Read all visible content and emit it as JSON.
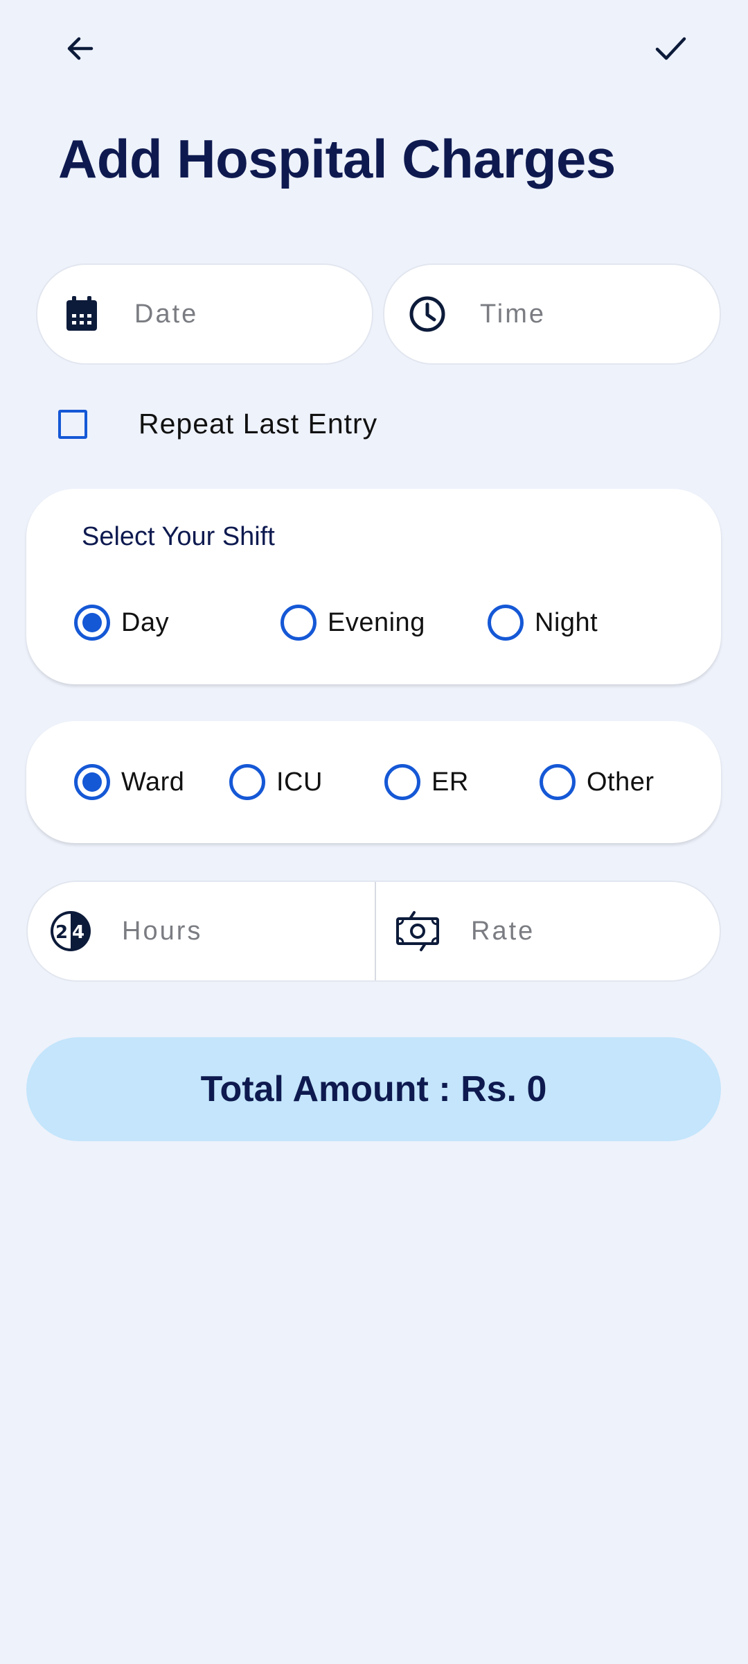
{
  "header": {
    "title": "Add Hospital Charges",
    "back_icon": "arrow-left-icon",
    "confirm_icon": "check-icon"
  },
  "datetime": {
    "date_placeholder": "Date",
    "time_placeholder": "Time",
    "date_icon": "calendar-icon",
    "time_icon": "clock-icon"
  },
  "repeat": {
    "label": "Repeat Last Entry",
    "checked": false
  },
  "shift": {
    "label": "Select Your Shift",
    "options": [
      "Day",
      "Evening",
      "Night"
    ],
    "selected": "Day"
  },
  "location": {
    "options": [
      "Ward",
      "ICU",
      "ER",
      "Other"
    ],
    "selected": "Ward"
  },
  "hours_rate": {
    "hours_placeholder": "Hours",
    "rate_placeholder": "Rate",
    "hours_icon": "24-hours-icon",
    "rate_icon": "money-icon"
  },
  "total": {
    "label": "Total Amount : Rs. 0"
  },
  "colors": {
    "background": "#eef2fb",
    "primary_blue": "#1558d6",
    "title_navy": "#0e1a4f",
    "total_bg": "#c4e5fb"
  }
}
